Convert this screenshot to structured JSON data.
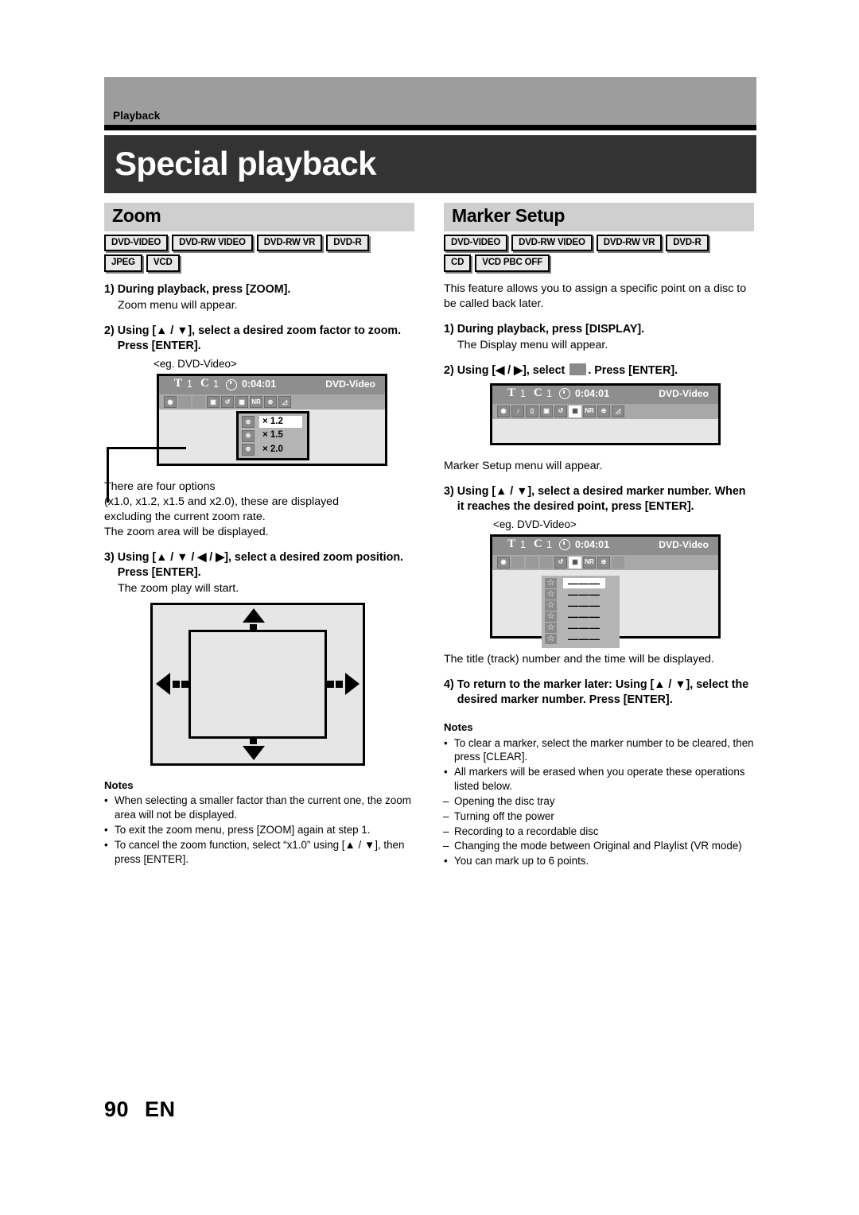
{
  "header": {
    "section_label": "Playback",
    "title": "Special playback"
  },
  "footer": {
    "page_number": "90",
    "language": "EN"
  },
  "left": {
    "section_title": "Zoom",
    "badges_row1": [
      "DVD-VIDEO",
      "DVD-RW VIDEO",
      "DVD-RW VR",
      "DVD-R"
    ],
    "badges_row2": [
      "JPEG",
      "VCD"
    ],
    "step1_num": "1)",
    "step1_text": "During playback, press [ZOOM].",
    "step1_sub": "Zoom menu will appear.",
    "step2_num": "2)",
    "step2_text": "Using [▲ / ▼], select a desired zoom factor to zoom. Press [ENTER].",
    "step2_eg": "<eg. DVD-Video>",
    "osd1": {
      "glyph_title": "T",
      "title_num": "1",
      "glyph_chapter": "C",
      "chapter_num": "1",
      "time": "0:04:01",
      "format": "DVD-Video",
      "icons": [
        "angle-icon",
        "blank-icon",
        "blank-icon",
        "camera-icon",
        "repeat-icon",
        "marker-icon",
        "nr-icon",
        "zoom-icon",
        "picture-icon"
      ],
      "icon_labels": [
        "",
        "",
        "",
        "",
        "",
        "",
        "NR",
        "",
        ""
      ],
      "zoom_options": [
        "× 1.2",
        "× 1.5",
        "× 2.0"
      ],
      "zoom_selected_index": 0
    },
    "after_osd1": [
      "There are four options",
      "(x1.0, x1.2, x1.5 and x2.0), these are displayed",
      "excluding the current zoom rate.",
      "The zoom area will be displayed."
    ],
    "step3_num": "3)",
    "step3_text": "Using [▲ / ▼ / ◀ / ▶], select a desired zoom position. Press [ENTER].",
    "step3_sub": "The zoom play will start.",
    "notes_head": "Notes",
    "notes": [
      "When selecting a smaller factor than the current one, the zoom area will not be displayed.",
      "To exit the zoom menu, press [ZOOM] again at step 1.",
      "To cancel the zoom function, select “x1.0” using [▲ / ▼], then press [ENTER]."
    ]
  },
  "right": {
    "section_title": "Marker Setup",
    "badges_row1": [
      "DVD-VIDEO",
      "DVD-RW VIDEO",
      "DVD-RW VR",
      "DVD-R"
    ],
    "badges_row2": [
      "CD",
      "VCD PBC OFF"
    ],
    "intro": "This feature allows you to assign a specific point on a disc to be called back later.",
    "step1_num": "1)",
    "step1_text": "During playback, press [DISPLAY].",
    "step1_sub": "The Display menu will appear.",
    "step2_num": "2)",
    "step2_text_before": "Using [◀ / ▶], select",
    "step2_text_after": ". Press [ENTER].",
    "osd2": {
      "glyph_title": "T",
      "title_num": "1",
      "glyph_chapter": "C",
      "chapter_num": "1",
      "time": "0:04:01",
      "format": "DVD-Video",
      "icons": [
        "angle-icon",
        "audio-icon",
        "subtitle-icon",
        "camera-icon",
        "repeat-icon",
        "marker-icon",
        "nr-icon",
        "zoom-icon",
        "picture-icon"
      ],
      "highlighted_icon": "marker-icon"
    },
    "after_osd2": "Marker Setup menu will appear.",
    "step3_num": "3)",
    "step3_text": "Using [▲ / ▼], select a desired marker number. When it reaches the desired point, press [ENTER].",
    "step3_eg": "<eg. DVD-Video>",
    "osd3": {
      "glyph_title": "T",
      "title_num": "1",
      "glyph_chapter": "C",
      "chapter_num": "1",
      "time": "0:04:01",
      "format": "DVD-Video",
      "icons": [
        "angle-icon",
        "blank-icon",
        "blank-icon",
        "blank-icon",
        "repeat-icon",
        "marker-icon",
        "nr-icon",
        "zoom-icon",
        "blank-icon"
      ],
      "marker_rows": [
        "———",
        "———",
        "———",
        "———",
        "———",
        "———"
      ],
      "marker_selected_index": 0
    },
    "after_osd3": "The title (track) number and the time will be displayed.",
    "step4_num": "4)",
    "step4_text": "To return to the marker later: Using [▲ / ▼], select the desired marker number. Press [ENTER].",
    "notes_head": "Notes",
    "notes": [
      {
        "mark": "•",
        "text": "To clear a marker, select the marker number to be cleared, then press [CLEAR]."
      },
      {
        "mark": "•",
        "text": "All markers will be erased when you operate these operations listed below."
      },
      {
        "mark": "–",
        "text": "Opening the disc tray"
      },
      {
        "mark": "–",
        "text": "Turning off the power"
      },
      {
        "mark": "–",
        "text": "Recording to a recordable disc"
      },
      {
        "mark": "–",
        "text": "Changing the mode between Original and Playlist (VR mode)"
      },
      {
        "mark": "•",
        "text": "You can mark up to 6 points."
      }
    ]
  },
  "colors": {
    "header_gray": "#9d9d9d",
    "title_dark": "#333333",
    "section_gray": "#cfcfcf",
    "osd_screen": "#e6e6e6",
    "osd_bar": "#8e8e8e",
    "osd_iconbar": "#a8a8a8"
  }
}
